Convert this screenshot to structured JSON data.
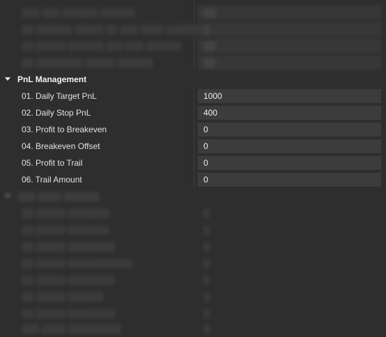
{
  "pnl_section": {
    "title": "PnL Management",
    "rows": [
      {
        "label": "01. Daily Target PnL",
        "value": "1000"
      },
      {
        "label": "02. Daily Stop PnL",
        "value": "400"
      },
      {
        "label": "03. Profit to Breakeven",
        "value": "0"
      },
      {
        "label": "04. Breakeven Offset",
        "value": "0"
      },
      {
        "label": "05. Profit to Trail",
        "value": "0"
      },
      {
        "label": "06. Trail Amount",
        "value": "0"
      }
    ]
  }
}
